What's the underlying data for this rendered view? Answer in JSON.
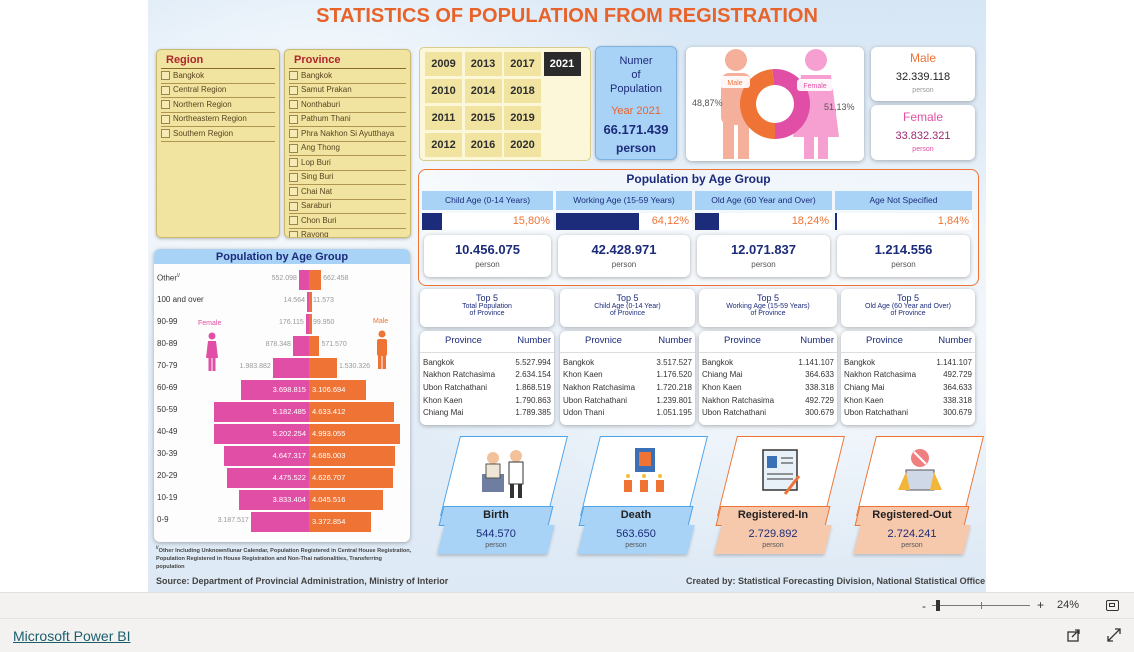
{
  "title": "STATISTICS OF POPULATION FROM REGISTRATION",
  "region": {
    "title": "Region",
    "items": [
      "Bangkok",
      "Central Region",
      "Northern Region",
      "Northeastern Region",
      "Southern Region"
    ]
  },
  "province": {
    "title": "Province",
    "items": [
      "Bangkok",
      "Samut Prakan",
      "Nonthaburi",
      "Pathum Thani",
      "Phra Nakhon Si Ayutthaya",
      "Ang Thong",
      "Lop Buri",
      "Sing Buri",
      "Chai Nat",
      "Saraburi",
      "Chon Buri",
      "Rayong"
    ]
  },
  "years": [
    "2009",
    "2013",
    "2017",
    "2021",
    "2010",
    "2014",
    "2018",
    "2011",
    "2015",
    "2019",
    "2012",
    "2016",
    "2020"
  ],
  "selected_year": "2021",
  "total": {
    "l1": "Numer",
    "l2": "of",
    "l3": "Population",
    "year": "Year  2021",
    "value": "66.171.439",
    "unit": "person"
  },
  "donut": {
    "male_label": "Male",
    "female_label": "Female",
    "male_pct": "48,87%",
    "female_pct": "51,13%"
  },
  "male": {
    "label": "Male",
    "value": "32.339.118",
    "unit": "person"
  },
  "female": {
    "label": "Female",
    "value": "33.832.321",
    "unit": "person"
  },
  "age_group": {
    "title": "Population by Age Group",
    "cols": [
      {
        "label": "Child Age (0-14 Years)",
        "pct": "15,80%",
        "pct_value": 15.8,
        "value": "10.456.075",
        "unit": "person"
      },
      {
        "label": "Working Age (15-59 Years)",
        "pct": "64,12%",
        "pct_value": 64.12,
        "value": "42.428.971",
        "unit": "person"
      },
      {
        "label": "Old Age (60 Year and Over)",
        "pct": "18,24%",
        "pct_value": 18.24,
        "value": "12.071.837",
        "unit": "person"
      },
      {
        "label": "Age Not Specified",
        "pct": "1,84%",
        "pct_value": 1.84,
        "value": "1.214.556",
        "unit": "person"
      }
    ]
  },
  "pyramid": {
    "title": "Population by Age Group",
    "female_label": "Female",
    "male_label": "Male",
    "rows": [
      {
        "age": "Other",
        "sup": "\\/",
        "female": "552.098",
        "male": "662.458",
        "fv": 552098,
        "mv": 662458
      },
      {
        "age": "100 and over",
        "female": "14.564",
        "male": "11.573",
        "fv": 14564,
        "mv": 11573
      },
      {
        "age": "90-99",
        "female": "176.115",
        "male": "99.950",
        "fv": 176115,
        "mv": 99950
      },
      {
        "age": "80-89",
        "female": "878.348",
        "male": "571.570",
        "fv": 878348,
        "mv": 571570
      },
      {
        "age": "70-79",
        "female": "1.983.882",
        "male": "1.530.326",
        "fv": 1983882,
        "mv": 1530326
      },
      {
        "age": "60-69",
        "female": "3.698.815",
        "male": "3.106.694",
        "fv": 3698815,
        "mv": 3106694
      },
      {
        "age": "50-59",
        "female": "5.182.485",
        "male": "4.633.412",
        "fv": 5182485,
        "mv": 4633412
      },
      {
        "age": "40-49",
        "female": "5.202.254",
        "male": "4.993.055",
        "fv": 5202254,
        "mv": 4993055
      },
      {
        "age": "30-39",
        "female": "4.647.317",
        "male": "4.685.003",
        "fv": 4647317,
        "mv": 4685003
      },
      {
        "age": "20-29",
        "female": "4.475.522",
        "male": "4.626.707",
        "fv": 4475522,
        "mv": 4626707
      },
      {
        "age": "10-19",
        "female": "3.833.404",
        "male": "4.045.516",
        "fv": 3833404,
        "mv": 4045516
      },
      {
        "age": "0-9",
        "female": "3.187.517",
        "male": "3.372.854",
        "fv": 3187517,
        "mv": 3372854
      }
    ],
    "footnote_sup": "\\/",
    "footnote": "Other Including Unknown/lunar Calendar, Population Registered in Central House Registration, Population Registered in House Registration and Non-Thai nationalities, Transferring population"
  },
  "top5": [
    {
      "h1": "Top 5",
      "h2": "Total Population",
      "h3": "of Province",
      "col1": "Province",
      "col2": "Number",
      "rows": [
        [
          "Bangkok",
          "5.527.994"
        ],
        [
          "Nakhon Ratchasima",
          "2.634.154"
        ],
        [
          "Ubon Ratchathani",
          "1.868.519"
        ],
        [
          "Khon Kaen",
          "1.790.863"
        ],
        [
          "Chiang Mai",
          "1.789.385"
        ]
      ]
    },
    {
      "h1": "Top 5",
      "h2": "Child Age (0-14 Year)",
      "h3": "of Province",
      "col1": "Provnice",
      "col2": "Number",
      "rows": [
        [
          "Bangkok",
          "3.517.527"
        ],
        [
          "Khon Kaen",
          "1.176.520"
        ],
        [
          "Nakhon Ratchasima",
          "1.720.218"
        ],
        [
          "Ubon Ratchathani",
          "1.239.801"
        ],
        [
          "Udon Thani",
          "1.051.195"
        ]
      ]
    },
    {
      "h1": "Top 5",
      "h2": "Working Age (15-59 Years)",
      "h3": "of Province",
      "col1": "Province",
      "col2": "Number",
      "rows": [
        [
          "Bangkok",
          "1.141.107"
        ],
        [
          "Chiang Mai",
          "364.633"
        ],
        [
          "Khon Kaen",
          "338.318"
        ],
        [
          "Nakhon Ratchasima",
          "492.729"
        ],
        [
          "Ubon Ratchathani",
          "300.679"
        ]
      ]
    },
    {
      "h1": "Top 5",
      "h2": "Old Age (60 Year and Over)",
      "h3": "of Province",
      "col1": "Province",
      "col2": "Number",
      "rows": [
        [
          "Bangkok",
          "1.141.107"
        ],
        [
          "Nakhon Ratchasima",
          "492.729"
        ],
        [
          "Chiang Mai",
          "364.633"
        ],
        [
          "Khon Kaen",
          "338.318"
        ],
        [
          "Ubon Ratchathani",
          "300.679"
        ]
      ]
    }
  ],
  "events": [
    {
      "label": "Birth",
      "value": "544.570",
      "unit": "person",
      "icon": "birth-icon"
    },
    {
      "label": "Death",
      "value": "563.650",
      "unit": "person",
      "icon": "death-icon"
    },
    {
      "label": "Registered-In",
      "value": "2.729.892",
      "unit": "person",
      "icon": "registered-in-icon"
    },
    {
      "label": "Registered-Out",
      "value": "2.724.241",
      "unit": "person",
      "icon": "registered-out-icon"
    }
  ],
  "source": "Source: Department of Provincial Administration, Ministry of Interior",
  "credit": "Created by: Statistical Forecasting Division, National Statistical Office",
  "zoom": {
    "minus": "-",
    "plus": "+",
    "level": "24%",
    "level_value": 24
  },
  "brand": "Microsoft Power BI",
  "colors": {
    "title": "#e8632a",
    "female": "#e04fa5",
    "male": "#ee7335",
    "navy": "#1c2b7a",
    "slicer": "#f1e4a0"
  }
}
